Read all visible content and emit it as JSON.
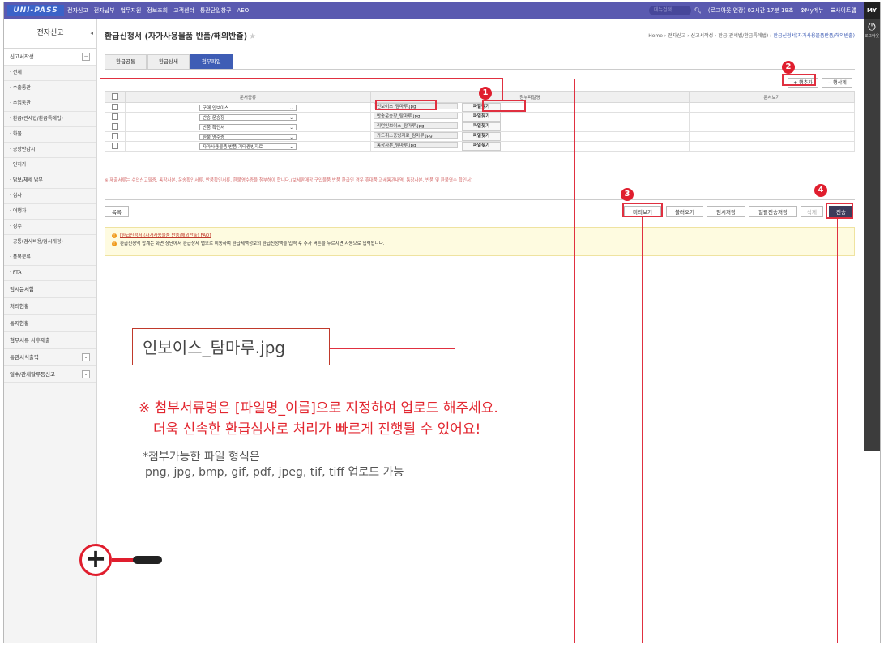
{
  "topbar": {
    "logo": "UNI-PASS",
    "nav": [
      "전자신고",
      "전자납부",
      "업무지원",
      "정보조회",
      "고객센터",
      "통관단일창구",
      "AEO"
    ],
    "search_placeholder": "메뉴검색",
    "session": "(로그아웃 연장) 02시간 17분 19초",
    "mymenu": "My메뉴",
    "sitemap": "사이트맵",
    "my": "MY",
    "right_panel_label": "로그아웃"
  },
  "sidebar": {
    "title": "전자신고",
    "section": "신고서작성",
    "items": [
      "전체",
      "수출통관",
      "수입통관",
      "환급(관세법/환급특례법)",
      "화물",
      "공항만감시",
      "인허가",
      "담보/체세 납부",
      "심사",
      "여행자",
      "징수",
      "공통(검사비용/임시개청)",
      "품목분류",
      "FTA"
    ],
    "groups": [
      "임시문서함",
      "처리현황",
      "통지현황",
      "첨부서류 사후제출",
      "통관서식출력",
      "일수/관세탈루등신고"
    ]
  },
  "page": {
    "title": "환급신청서 (자가사용물품 반품/해외반출)",
    "breadcrumb": [
      "Home",
      "전자신고",
      "신고서작성",
      "환급(관세법/환급특례법)"
    ],
    "breadcrumb_current": "환급신청서(자가사용물품반품/해외반출)",
    "tabs": [
      "환급공통",
      "환급상세",
      "첨부파일"
    ],
    "add_row": "+ 행추가",
    "del_row": "− 행삭제"
  },
  "table": {
    "headers": [
      "문서종류",
      "첨부파일명",
      "문서보기"
    ],
    "find_label": "파일찾기",
    "rows": [
      {
        "doc_type": "구매 인보이스",
        "file": "인보이스_탐마루.jpg"
      },
      {
        "doc_type": "반송 운송장",
        "file": "반송운송장_탐마루.jpg"
      },
      {
        "doc_type": "반품 확인서",
        "file": "리턴인보이스_탐마루.jpg"
      },
      {
        "doc_type": "환불 영수증",
        "file": "카드취소증빙자료_탐마루.jpg"
      },
      {
        "doc_type": "자가사용물품 반품 기타증빙자료",
        "file": "통장사본_탐마루.jpg"
      }
    ]
  },
  "note": "※ 제출서류는 수입신고필증, 통장사본, 운송확인서류, 반품확인서류, 환불영수증을 첨부해야 합니다.(보세판매장 구입물품 반품 환급인 경우 휴대품 과세통관내역, 통장사본, 반품 및 환불영수 확인서)",
  "buttons": {
    "list": "목록",
    "preview": "미리보기",
    "load": "불러오기",
    "temp_save": "임시저장",
    "batch_save": "일괄전송저장",
    "delete": "삭제",
    "send": "전송"
  },
  "notice": {
    "link": "[환급신청서 (자가사용물품 반품/해외반출) FAQ]",
    "text": "환급신청액 합계는 화면 상단에서 환급상세 탭으로 이동하여 환급세액정보의 환급신청액을 입력 후 추가 버튼을 누르시면 자동으로 입력됩니다."
  },
  "annotations": {
    "numbers": [
      "1",
      "2",
      "3",
      "4"
    ],
    "zoom_filename": "인보이스_탐마루.jpg",
    "msg_line1": "※ 첨부서류명은 [파일명_이름]으로 지정하여 업로드 해주세요.",
    "msg_line2": "더욱 신속한 환급심사로 처리가 빠르게 진행될 수 있어요!",
    "formats_line1": "*첨부가능한 파일 형식은",
    "formats_line2": "png, jpg, bmp, gif, pdf, jpeg, tif, tiff 업로드 가능"
  },
  "colors": {
    "brand": "#5a5ab0",
    "accent": "#3e5db5",
    "annotation": "#e01e2e"
  }
}
